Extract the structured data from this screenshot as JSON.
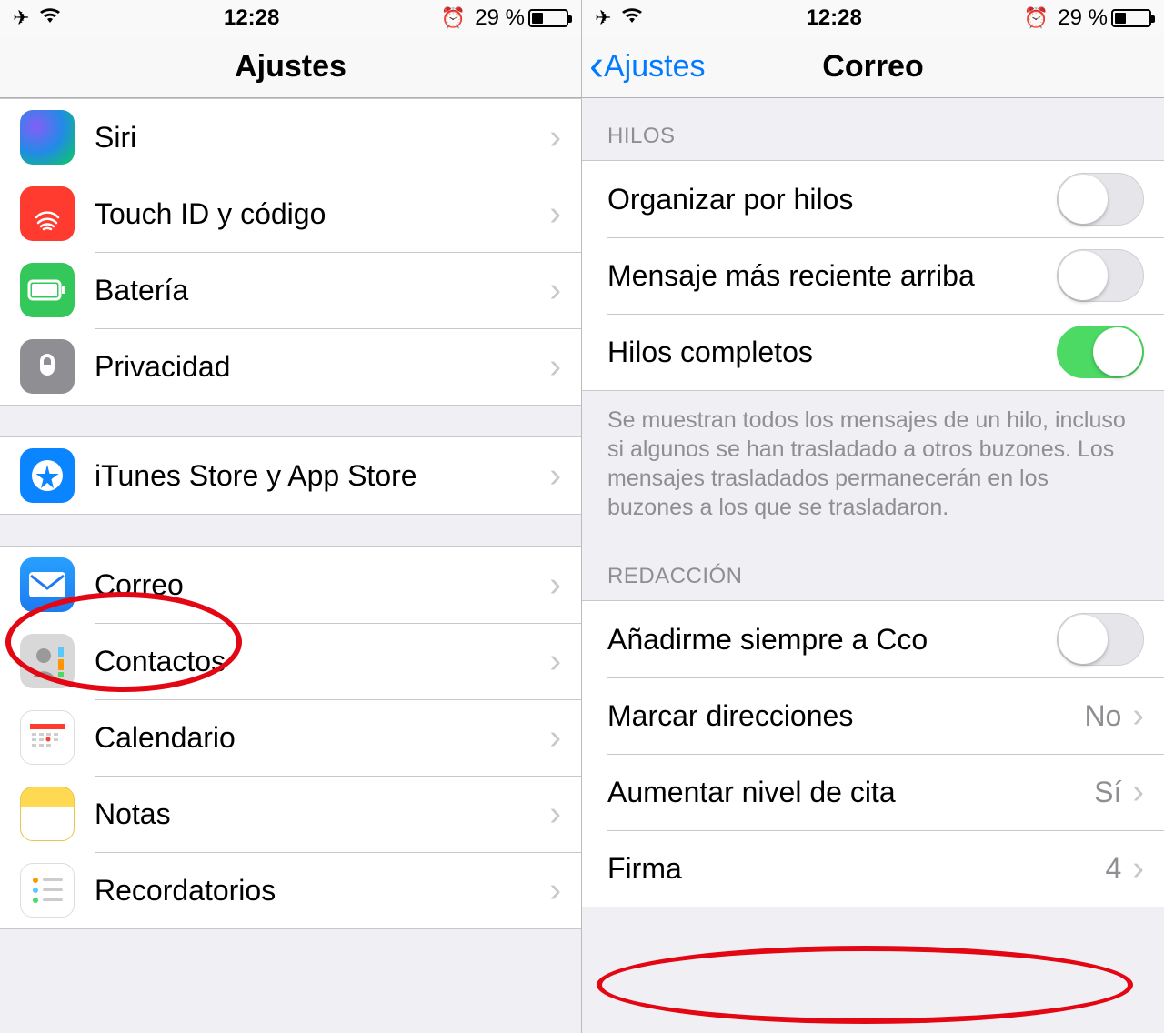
{
  "statusbar": {
    "time": "12:28",
    "battery_text": "29 %",
    "battery_pct": 29
  },
  "left": {
    "title": "Ajustes",
    "rows_top": [
      {
        "label": "Siri",
        "icon": "siri",
        "name": "settings-row-siri"
      },
      {
        "label": "Touch ID y código",
        "icon": "touchid",
        "name": "settings-row-touchid"
      },
      {
        "label": "Batería",
        "icon": "battery",
        "name": "settings-row-battery"
      },
      {
        "label": "Privacidad",
        "icon": "privacy",
        "name": "settings-row-privacy"
      }
    ],
    "row_store": {
      "label": "iTunes Store y App Store",
      "icon": "store",
      "name": "settings-row-itunes-store"
    },
    "rows_apps": [
      {
        "label": "Correo",
        "icon": "mail",
        "name": "settings-row-mail"
      },
      {
        "label": "Contactos",
        "icon": "contacts",
        "name": "settings-row-contacts"
      },
      {
        "label": "Calendario",
        "icon": "calendar",
        "name": "settings-row-calendar"
      },
      {
        "label": "Notas",
        "icon": "notes",
        "name": "settings-row-notes"
      },
      {
        "label": "Recordatorios",
        "icon": "reminders",
        "name": "settings-row-reminders"
      }
    ]
  },
  "right": {
    "back": "Ajustes",
    "title": "Correo",
    "hilos_header": "HILOS",
    "hilos_rows": [
      {
        "label": "Organizar por hilos",
        "type": "switch",
        "on": false,
        "name": "mail-row-organize-threads"
      },
      {
        "label": "Mensaje más reciente arriba",
        "type": "switch",
        "on": false,
        "name": "mail-row-recent-top"
      },
      {
        "label": "Hilos completos",
        "type": "switch",
        "on": true,
        "name": "mail-row-complete-threads"
      }
    ],
    "hilos_footer": "Se muestran todos los mensajes de un hilo, incluso si algunos se han trasladado a otros buzones. Los mensajes trasladados permanecerán en los buzones a los que se trasladaron.",
    "redaccion_header": "REDACCIÓN",
    "redaccion_rows": [
      {
        "label": "Añadirme siempre a Cco",
        "type": "switch",
        "on": false,
        "name": "mail-row-always-bcc"
      },
      {
        "label": "Marcar direcciones",
        "type": "value",
        "value": "No",
        "name": "mail-row-mark-addresses"
      },
      {
        "label": "Aumentar nivel de cita",
        "type": "value",
        "value": "Sí",
        "name": "mail-row-quote-level"
      },
      {
        "label": "Firma",
        "type": "value",
        "value": "4",
        "name": "mail-row-signature"
      }
    ]
  }
}
